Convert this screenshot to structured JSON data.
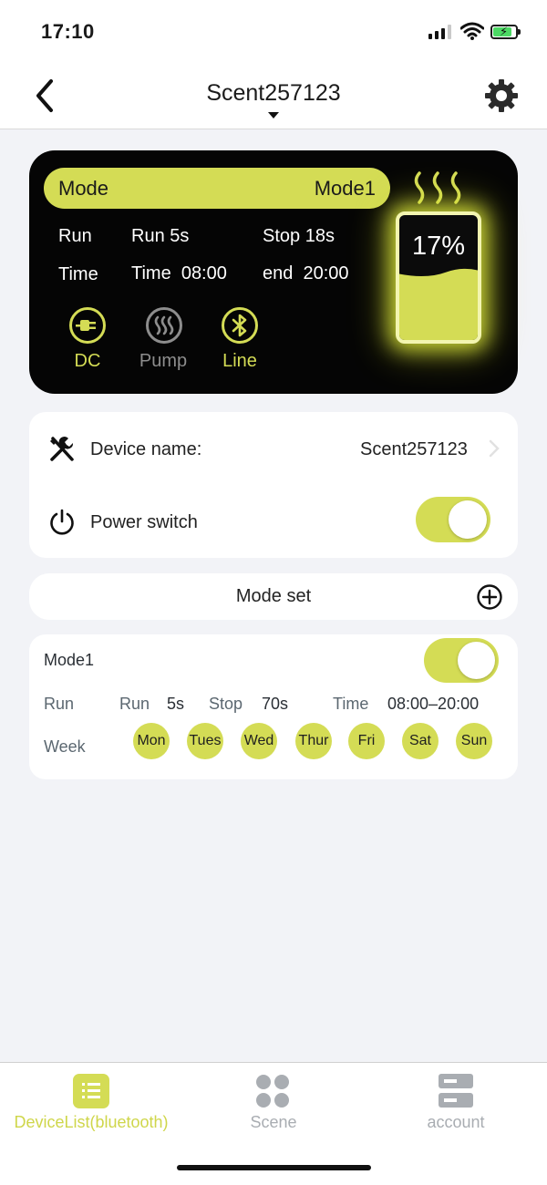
{
  "status_bar": {
    "time": "17:10"
  },
  "nav": {
    "title": "Scent257123"
  },
  "status_card": {
    "mode_label": "Mode",
    "mode_value": "Mode1",
    "run_label": "Run",
    "run_value": "Run 5s",
    "stop_value": "Stop 18s",
    "time_label": "Time",
    "time_value": "Time  08:00",
    "end_value": "end  20:00",
    "indicators": [
      {
        "label": "DC",
        "icon": "plug-icon",
        "active": true
      },
      {
        "label": "Pump",
        "icon": "heat-icon",
        "active": false
      },
      {
        "label": "Line",
        "icon": "bluetooth-icon",
        "active": true
      }
    ],
    "tank_level_text": "17%",
    "tank_level_fraction": 0.17,
    "accent_color": "#d4dc55"
  },
  "device": {
    "name_label": "Device name:",
    "name_value": "Scent257123",
    "power_label": "Power switch",
    "power_on": true
  },
  "mode_set": {
    "label": "Mode set"
  },
  "mode_entry": {
    "name": "Mode1",
    "enabled": true,
    "run_label": "Run",
    "run_text": "Run",
    "run_value": "5s",
    "stop_text": "Stop",
    "stop_value": "70s",
    "time_text": "Time",
    "time_value": "08:00–20:00",
    "week_label": "Week",
    "days": [
      "Mon",
      "Tues",
      "Wed",
      "Thur",
      "Fri",
      "Sat",
      "Sun"
    ]
  },
  "tabs": [
    {
      "label": "DeviceList(bluetooth)",
      "icon": "list-icon",
      "active": true
    },
    {
      "label": "Scene",
      "icon": "grid-icon",
      "active": false
    },
    {
      "label": "account",
      "icon": "server-icon",
      "active": false
    }
  ],
  "colors": {
    "accent": "#d4dc55",
    "active_text": "#cfd64a",
    "inactive_text": "#a9adb2"
  }
}
